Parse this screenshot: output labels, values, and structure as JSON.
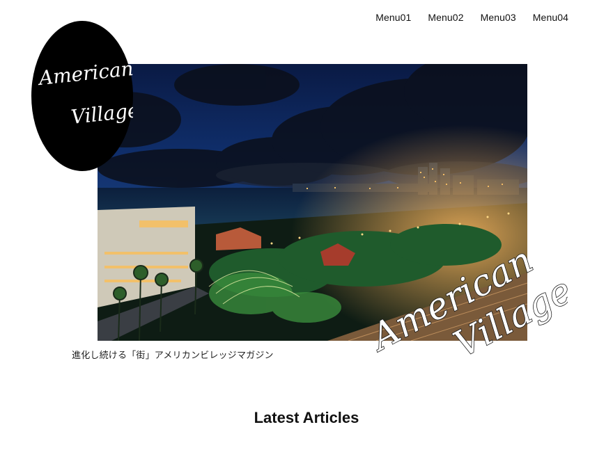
{
  "nav": {
    "items": [
      {
        "label": "Menu01"
      },
      {
        "label": "Menu02"
      },
      {
        "label": "Menu03"
      },
      {
        "label": "Menu04"
      }
    ]
  },
  "logo": {
    "line1": "American",
    "line2": "Village"
  },
  "overlay_script": {
    "line1": "American",
    "line2": "Village"
  },
  "hero": {
    "image": "night-view-of-american-village"
  },
  "tagline": "進化し続ける「街」アメリカンビレッジマガジン",
  "section": {
    "title": "Latest Articles"
  },
  "colors": {
    "background": "#ffffff",
    "logo_bg": "#000000",
    "text": "#111111"
  }
}
